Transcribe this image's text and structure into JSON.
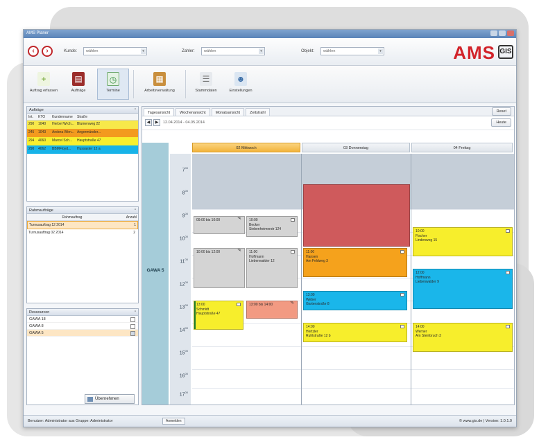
{
  "window": {
    "title": "AMS Planer"
  },
  "address": {
    "kunde_label": "Kunde:",
    "kunde_value": "wählen",
    "zahler_label": "Zahler:",
    "zahler_value": "wählen",
    "objekt_label": "Objekt:",
    "objekt_value": "wählen"
  },
  "brand": {
    "name": "AMS",
    "mark": "GIS"
  },
  "ribbon": [
    {
      "label": "Auftrag erfassen",
      "icon": "document-add-icon"
    },
    {
      "label": "Aufträge",
      "icon": "book-icon"
    },
    {
      "label": "Termine",
      "icon": "calendar-clock-icon"
    },
    {
      "label": "Arbeitsverwaltung",
      "icon": "ledger-icon"
    },
    {
      "label": "Stammdaten",
      "icon": "database-icon"
    },
    {
      "label": "Einstellungen",
      "icon": "user-settings-icon"
    }
  ],
  "auftraege": {
    "title": "Aufträge",
    "columns": [
      "Int.",
      "KTO",
      "Kundenname",
      "Straße"
    ],
    "rows": [
      [
        "290",
        "1040",
        "Herbel Wrch...",
        "Blumenweg 22"
      ],
      [
        "245",
        "1043",
        "Andera Wirn...",
        "Angermünder..."
      ],
      [
        "294",
        "4060",
        "Marcel Sch...",
        "Hauptstraße 47"
      ],
      [
        "290",
        "4062",
        "BBMFloyd...",
        "Hussaster 12 a"
      ]
    ]
  },
  "rahmen": {
    "title": "Rahmaufträge",
    "columns": [
      "Rahmauftrag",
      "Anzahl"
    ],
    "rows": [
      [
        "Turnusauftrag 12 2014",
        "1"
      ],
      [
        "Turnusauftrag 02 2014",
        "2"
      ]
    ]
  },
  "ressourcen": {
    "title": "Ressourcen",
    "rows": [
      "GAWA 18",
      "GAWA 8",
      "GAWA 5"
    ],
    "button": "Übernehmen"
  },
  "tabs": [
    "Tagesansicht",
    "Wochenansicht",
    "Monatsansicht",
    "Zeitstrahl"
  ],
  "toolbar": {
    "reset": "Reset",
    "heute": "Heute",
    "range": "12.04.2014 - 04.05.2014"
  },
  "calendar": {
    "resource": "GAWA 5",
    "hours": [
      "7",
      "8",
      "9",
      "10",
      "11",
      "12",
      "13",
      "14",
      "15",
      "16",
      "17"
    ],
    "days": [
      "02 Mittwoch",
      "03 Donnerstag",
      "04 Freitag"
    ],
    "events": [
      {
        "day": 0,
        "text": "09:00 bis 10:00",
        "sub": "",
        "color": "gray"
      },
      {
        "day": 0,
        "text": "10:00",
        "sub": "Becker\nSiebenheimerstr 124",
        "color": "gray"
      },
      {
        "day": 0,
        "text": "10:00 bis 12:00",
        "sub": "",
        "color": "gray"
      },
      {
        "day": 0,
        "text": "11:00",
        "sub": "Hoffmann\nLiebenwalder 12",
        "color": "gray"
      },
      {
        "day": 0,
        "text": "13:00",
        "sub": "Schmidt\nHauptstraße 47",
        "color": "yellow"
      },
      {
        "day": 0,
        "text": "13:00 bis 14:00",
        "sub": "",
        "color": "salmon"
      },
      {
        "day": 1,
        "text": "",
        "sub": "",
        "color": "red"
      },
      {
        "day": 1,
        "text": "11:00",
        "sub": "Hansen\nAm Feldweg 3",
        "color": "orange"
      },
      {
        "day": 1,
        "text": "13:00",
        "sub": "Weber\nGartenstraße 8",
        "color": "blue"
      },
      {
        "day": 1,
        "text": "14:00",
        "sub": "Hertzler\nRuhlstraße 12 b",
        "color": "yellow"
      },
      {
        "day": 2,
        "text": "10:00",
        "sub": "Fischer\nLindenweg 15",
        "color": "yellow"
      },
      {
        "day": 2,
        "text": "12:00",
        "sub": "Hoffmann\nLiebenwalder 9",
        "color": "blue"
      },
      {
        "day": 2,
        "text": "14:00",
        "sub": "Werner\nAm Steinbruch 3",
        "color": "yellow"
      }
    ]
  },
  "status": {
    "user": "Benutzer: Administrator aus Gruppe: Administrator",
    "anmelden": "Anmelden",
    "version": "© www.gis.de | Version: 1.0.1.0"
  }
}
